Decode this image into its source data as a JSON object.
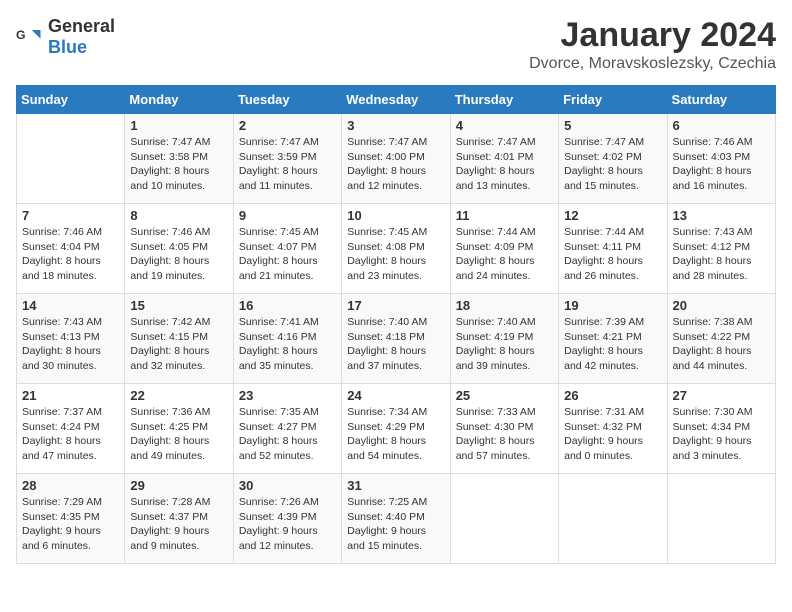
{
  "logo": {
    "general": "General",
    "blue": "Blue"
  },
  "title": "January 2024",
  "subtitle": "Dvorce, Moravskoslezsky, Czechia",
  "days_of_week": [
    "Sunday",
    "Monday",
    "Tuesday",
    "Wednesday",
    "Thursday",
    "Friday",
    "Saturday"
  ],
  "weeks": [
    [
      {
        "day": "",
        "info": ""
      },
      {
        "day": "1",
        "info": "Sunrise: 7:47 AM\nSunset: 3:58 PM\nDaylight: 8 hours\nand 10 minutes."
      },
      {
        "day": "2",
        "info": "Sunrise: 7:47 AM\nSunset: 3:59 PM\nDaylight: 8 hours\nand 11 minutes."
      },
      {
        "day": "3",
        "info": "Sunrise: 7:47 AM\nSunset: 4:00 PM\nDaylight: 8 hours\nand 12 minutes."
      },
      {
        "day": "4",
        "info": "Sunrise: 7:47 AM\nSunset: 4:01 PM\nDaylight: 8 hours\nand 13 minutes."
      },
      {
        "day": "5",
        "info": "Sunrise: 7:47 AM\nSunset: 4:02 PM\nDaylight: 8 hours\nand 15 minutes."
      },
      {
        "day": "6",
        "info": "Sunrise: 7:46 AM\nSunset: 4:03 PM\nDaylight: 8 hours\nand 16 minutes."
      }
    ],
    [
      {
        "day": "7",
        "info": "Sunrise: 7:46 AM\nSunset: 4:04 PM\nDaylight: 8 hours\nand 18 minutes."
      },
      {
        "day": "8",
        "info": "Sunrise: 7:46 AM\nSunset: 4:05 PM\nDaylight: 8 hours\nand 19 minutes."
      },
      {
        "day": "9",
        "info": "Sunrise: 7:45 AM\nSunset: 4:07 PM\nDaylight: 8 hours\nand 21 minutes."
      },
      {
        "day": "10",
        "info": "Sunrise: 7:45 AM\nSunset: 4:08 PM\nDaylight: 8 hours\nand 23 minutes."
      },
      {
        "day": "11",
        "info": "Sunrise: 7:44 AM\nSunset: 4:09 PM\nDaylight: 8 hours\nand 24 minutes."
      },
      {
        "day": "12",
        "info": "Sunrise: 7:44 AM\nSunset: 4:11 PM\nDaylight: 8 hours\nand 26 minutes."
      },
      {
        "day": "13",
        "info": "Sunrise: 7:43 AM\nSunset: 4:12 PM\nDaylight: 8 hours\nand 28 minutes."
      }
    ],
    [
      {
        "day": "14",
        "info": "Sunrise: 7:43 AM\nSunset: 4:13 PM\nDaylight: 8 hours\nand 30 minutes."
      },
      {
        "day": "15",
        "info": "Sunrise: 7:42 AM\nSunset: 4:15 PM\nDaylight: 8 hours\nand 32 minutes."
      },
      {
        "day": "16",
        "info": "Sunrise: 7:41 AM\nSunset: 4:16 PM\nDaylight: 8 hours\nand 35 minutes."
      },
      {
        "day": "17",
        "info": "Sunrise: 7:40 AM\nSunset: 4:18 PM\nDaylight: 8 hours\nand 37 minutes."
      },
      {
        "day": "18",
        "info": "Sunrise: 7:40 AM\nSunset: 4:19 PM\nDaylight: 8 hours\nand 39 minutes."
      },
      {
        "day": "19",
        "info": "Sunrise: 7:39 AM\nSunset: 4:21 PM\nDaylight: 8 hours\nand 42 minutes."
      },
      {
        "day": "20",
        "info": "Sunrise: 7:38 AM\nSunset: 4:22 PM\nDaylight: 8 hours\nand 44 minutes."
      }
    ],
    [
      {
        "day": "21",
        "info": "Sunrise: 7:37 AM\nSunset: 4:24 PM\nDaylight: 8 hours\nand 47 minutes."
      },
      {
        "day": "22",
        "info": "Sunrise: 7:36 AM\nSunset: 4:25 PM\nDaylight: 8 hours\nand 49 minutes."
      },
      {
        "day": "23",
        "info": "Sunrise: 7:35 AM\nSunset: 4:27 PM\nDaylight: 8 hours\nand 52 minutes."
      },
      {
        "day": "24",
        "info": "Sunrise: 7:34 AM\nSunset: 4:29 PM\nDaylight: 8 hours\nand 54 minutes."
      },
      {
        "day": "25",
        "info": "Sunrise: 7:33 AM\nSunset: 4:30 PM\nDaylight: 8 hours\nand 57 minutes."
      },
      {
        "day": "26",
        "info": "Sunrise: 7:31 AM\nSunset: 4:32 PM\nDaylight: 9 hours\nand 0 minutes."
      },
      {
        "day": "27",
        "info": "Sunrise: 7:30 AM\nSunset: 4:34 PM\nDaylight: 9 hours\nand 3 minutes."
      }
    ],
    [
      {
        "day": "28",
        "info": "Sunrise: 7:29 AM\nSunset: 4:35 PM\nDaylight: 9 hours\nand 6 minutes."
      },
      {
        "day": "29",
        "info": "Sunrise: 7:28 AM\nSunset: 4:37 PM\nDaylight: 9 hours\nand 9 minutes."
      },
      {
        "day": "30",
        "info": "Sunrise: 7:26 AM\nSunset: 4:39 PM\nDaylight: 9 hours\nand 12 minutes."
      },
      {
        "day": "31",
        "info": "Sunrise: 7:25 AM\nSunset: 4:40 PM\nDaylight: 9 hours\nand 15 minutes."
      },
      {
        "day": "",
        "info": ""
      },
      {
        "day": "",
        "info": ""
      },
      {
        "day": "",
        "info": ""
      }
    ]
  ]
}
